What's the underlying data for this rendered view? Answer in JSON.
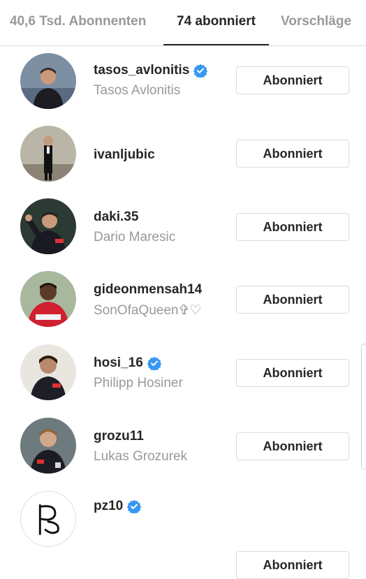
{
  "tabs": {
    "followers": "40,6 Tsd. Abonnenten",
    "following": "74 abonniert",
    "suggestions": "Vorschläge"
  },
  "colors": {
    "verified": "#3897f0",
    "text_primary": "#262626",
    "text_secondary": "#999999",
    "border": "#dbdbdb"
  },
  "accounts": [
    {
      "username": "tasos_avlonitis",
      "full_name": "Tasos Avlonitis",
      "verified": true,
      "button": "Abonniert"
    },
    {
      "username": "ivanljubic",
      "full_name": "",
      "verified": false,
      "button": "Abonniert"
    },
    {
      "username": "daki.35",
      "full_name": "Dario Maresic",
      "verified": false,
      "button": "Abonniert"
    },
    {
      "username": "gideonmensah14",
      "full_name": "SonOfaQueen✞♡",
      "verified": false,
      "button": "Abonniert"
    },
    {
      "username": "hosi_16",
      "full_name": "Philipp Hosiner",
      "verified": true,
      "button": "Abonniert"
    },
    {
      "username": "grozu11",
      "full_name": "Lukas Grozurek",
      "verified": false,
      "button": "Abonniert"
    },
    {
      "username": "pz10",
      "full_name": "",
      "verified": true,
      "button": "Abonniert"
    }
  ]
}
